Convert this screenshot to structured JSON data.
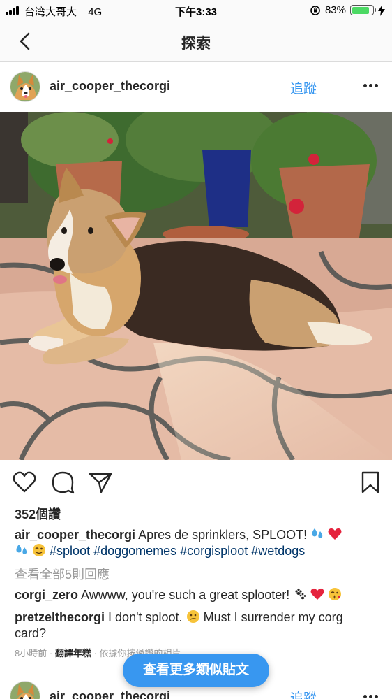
{
  "status_bar": {
    "carrier": "台湾大哥大",
    "network": "4G",
    "time": "下午3:33",
    "battery": "83%",
    "battery_level": 0.83
  },
  "nav": {
    "title": "探索"
  },
  "post": {
    "username": "air_cooper_thecorgi",
    "follow_label": "追蹤",
    "likes": "352個讚",
    "caption": {
      "username": "air_cooper_thecorgi",
      "text": "Apres de sprinklers, SPLOOT!",
      "hashtags": "#sploot #doggomemes #corgisploot #wetdogs"
    },
    "view_all_comments": "查看全部5則回應",
    "comments": [
      {
        "username": "corgi_zero",
        "text": "Awwww, you're such a great splooter!"
      },
      {
        "username": "pretzelthecorgi",
        "text": "I don't sploot.",
        "text2": "Must I surrender my corg card?"
      }
    ],
    "time_ago": "8小時前",
    "translate_label": "翻譯年糕",
    "suggestion_note": "依據你按過讚的相片"
  },
  "floating_button": {
    "label": "查看更多類似貼文"
  },
  "next_post": {
    "username": "air_cooper_thecorgi",
    "follow_label": "追蹤"
  },
  "colors": {
    "accent": "#3897f0",
    "hashtag": "#003569",
    "battery_fill": "#4cd964"
  }
}
